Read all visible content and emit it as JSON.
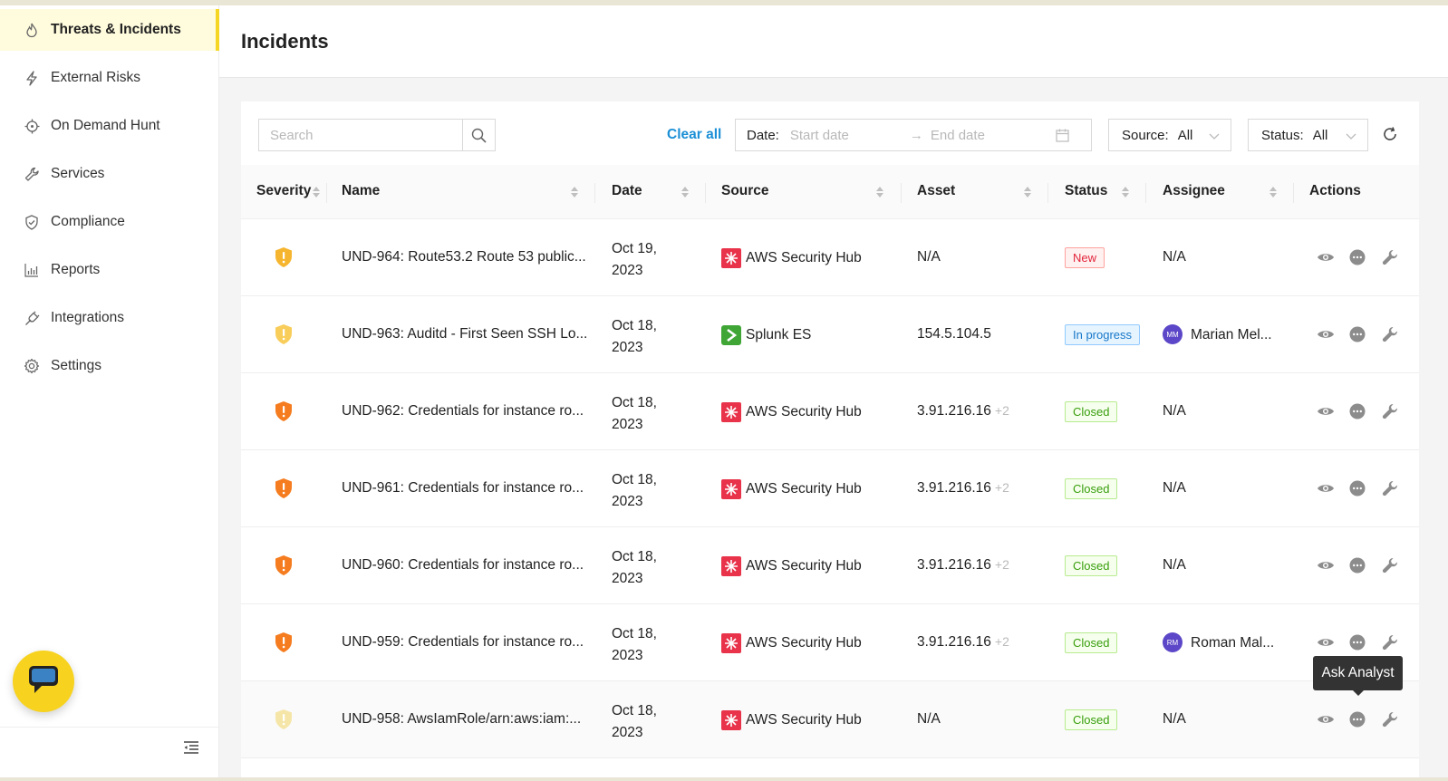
{
  "sidebar": {
    "items": [
      {
        "label": "Threats & Incidents",
        "icon": "flame-icon",
        "active": true
      },
      {
        "label": "External Risks",
        "icon": "lightning-icon"
      },
      {
        "label": "On Demand Hunt",
        "icon": "crosshair-icon"
      },
      {
        "label": "Services",
        "icon": "wrench-icon"
      },
      {
        "label": "Compliance",
        "icon": "shield-check-icon"
      },
      {
        "label": "Reports",
        "icon": "bar-chart-icon"
      },
      {
        "label": "Integrations",
        "icon": "plug-icon"
      },
      {
        "label": "Settings",
        "icon": "gear-icon"
      }
    ]
  },
  "header": {
    "title": "Incidents"
  },
  "filters": {
    "search_placeholder": "Search",
    "clear_all": "Clear all",
    "date_label": "Date:",
    "start_placeholder": "Start date",
    "end_placeholder": "End date",
    "source_label": "Source:",
    "source_value": "All",
    "status_label": "Status:",
    "status_value": "All"
  },
  "table": {
    "columns": [
      "Severity",
      "Name",
      "Date",
      "Source",
      "Asset",
      "Status",
      "Assignee",
      "Actions"
    ],
    "rows": [
      {
        "severity": "medium",
        "name": "UND-964: Route53.2 Route 53 public...",
        "date1": "Oct 19,",
        "date2": "2023",
        "source": "AWS Security Hub",
        "source_icon": "aws-security-hub-icon",
        "asset": "N/A",
        "asset_extra": "",
        "status": "New",
        "status_kind": "new",
        "assignee": "N/A",
        "initials": ""
      },
      {
        "severity": "low",
        "name": "UND-963: Auditd - First Seen SSH Lo...",
        "date1": "Oct 18,",
        "date2": "2023",
        "source": "Splunk ES",
        "source_icon": "splunk-icon",
        "asset": "154.5.104.5",
        "asset_extra": "",
        "status": "In progress",
        "status_kind": "prog",
        "assignee": "Marian Mel...",
        "initials": "MM"
      },
      {
        "severity": "high",
        "name": "UND-962: Credentials for instance ro...",
        "date1": "Oct 18,",
        "date2": "2023",
        "source": "AWS Security Hub",
        "source_icon": "aws-security-hub-icon",
        "asset": "3.91.216.16",
        "asset_extra": "+2",
        "status": "Closed",
        "status_kind": "closed",
        "assignee": "N/A",
        "initials": ""
      },
      {
        "severity": "high",
        "name": "UND-961: Credentials for instance ro...",
        "date1": "Oct 18,",
        "date2": "2023",
        "source": "AWS Security Hub",
        "source_icon": "aws-security-hub-icon",
        "asset": "3.91.216.16",
        "asset_extra": "+2",
        "status": "Closed",
        "status_kind": "closed",
        "assignee": "N/A",
        "initials": ""
      },
      {
        "severity": "high",
        "name": "UND-960: Credentials for instance ro...",
        "date1": "Oct 18,",
        "date2": "2023",
        "source": "AWS Security Hub",
        "source_icon": "aws-security-hub-icon",
        "asset": "3.91.216.16",
        "asset_extra": "+2",
        "status": "Closed",
        "status_kind": "closed",
        "assignee": "N/A",
        "initials": ""
      },
      {
        "severity": "high",
        "name": "UND-959: Credentials for instance ro...",
        "date1": "Oct 18,",
        "date2": "2023",
        "source": "AWS Security Hub",
        "source_icon": "aws-security-hub-icon",
        "asset": "3.91.216.16",
        "asset_extra": "+2",
        "status": "Closed",
        "status_kind": "closed",
        "assignee": "Roman Mal...",
        "initials": "RM"
      },
      {
        "severity": "info",
        "name": "UND-958: AwsIamRole/arn:aws:iam:...",
        "date1": "Oct 18,",
        "date2": "2023",
        "source": "AWS Security Hub",
        "source_icon": "aws-security-hub-icon",
        "asset": "N/A",
        "asset_extra": "",
        "status": "Closed",
        "status_kind": "closed",
        "assignee": "N/A",
        "initials": ""
      }
    ]
  },
  "tooltip": {
    "text": "Ask Analyst"
  },
  "colors": {
    "accent_yellow": "#f7d21e",
    "link_blue": "#1b8fd6",
    "severity_high": "#f57c1f",
    "severity_medium": "#f6b52e",
    "severity_low": "#f8cd5a",
    "severity_info": "#f5e6a8",
    "aws_red": "#e8334a",
    "splunk_green": "#3fa535",
    "avatar_purple": "#5b47c7"
  }
}
